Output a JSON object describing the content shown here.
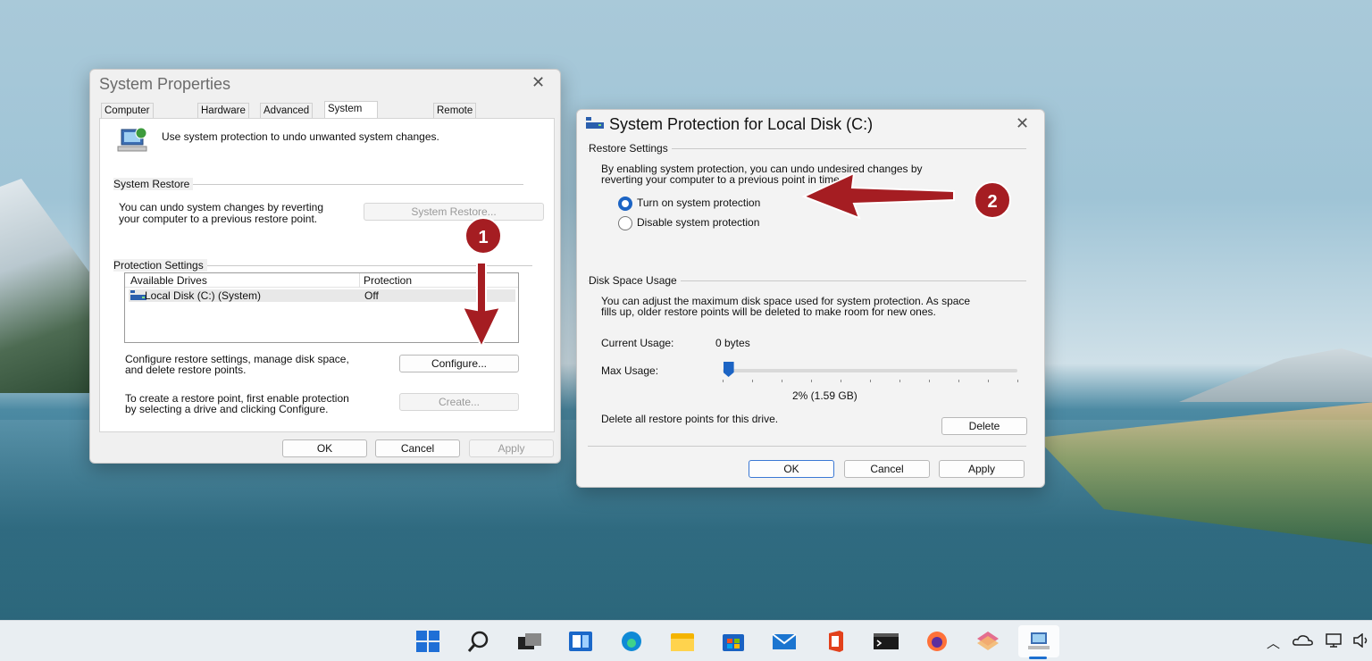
{
  "system_properties": {
    "title": "System Properties",
    "tabs": [
      "Computer Name",
      "Hardware",
      "Advanced",
      "System Protection",
      "Remote"
    ],
    "active_tab": "System Protection",
    "intro_text": "Use system protection to undo unwanted system changes.",
    "system_restore": {
      "group_title": "System Restore",
      "description_line1": "You can undo system changes by reverting",
      "description_line2": "your computer to a previous restore point.",
      "button_label": "System Restore..."
    },
    "protection_settings": {
      "group_title": "Protection Settings",
      "columns": [
        "Available Drives",
        "Protection"
      ],
      "rows": [
        {
          "drive": "Local Disk (C:) (System)",
          "protection": "Off",
          "icon": "drive-icon"
        }
      ],
      "configure_text_line1": "Configure restore settings, manage disk space,",
      "configure_text_line2": "and delete restore points.",
      "configure_button": "Configure...",
      "create_text_line1": "To create a restore point, first enable protection",
      "create_text_line2": "by selecting a drive and clicking Configure.",
      "create_button": "Create..."
    },
    "footer": {
      "ok": "OK",
      "cancel": "Cancel",
      "apply": "Apply"
    }
  },
  "system_protection_dialog": {
    "title": "System Protection for Local Disk (C:)",
    "restore_settings": {
      "group_title": "Restore Settings",
      "description_line1": "By enabling system protection, you can undo undesired changes by",
      "description_line2": "reverting your computer to a previous point in time.",
      "options": [
        {
          "label": "Turn on system protection",
          "checked": true
        },
        {
          "label": "Disable system protection",
          "checked": false
        }
      ]
    },
    "disk_space": {
      "group_title": "Disk Space Usage",
      "description_line1": "You can adjust the maximum disk space used for system protection. As space",
      "description_line2": "fills up, older restore points will be deleted to make room for new ones.",
      "current_usage_label": "Current Usage:",
      "current_usage_value": "0 bytes",
      "max_usage_label": "Max Usage:",
      "max_usage_fraction": 0.02,
      "max_usage_display": "2% (1.59 GB)",
      "delete_text": "Delete all restore points for this drive.",
      "delete_button": "Delete"
    },
    "footer": {
      "ok": "OK",
      "cancel": "Cancel",
      "apply": "Apply"
    }
  },
  "annotations": {
    "step1": "1",
    "step2": "2",
    "arrow_color": "#a51d22"
  },
  "taskbar": {
    "icons": [
      "start-icon",
      "search-icon",
      "task-view-icon",
      "widgets-icon",
      "edge-icon",
      "file-explorer-icon",
      "store-icon",
      "mail-icon",
      "office-icon",
      "terminal-icon",
      "firefox-icon",
      "snipping-icon",
      "system-properties-icon"
    ],
    "tray_icons": [
      "chevron-up-icon",
      "onedrive-icon",
      "network-icon",
      "volume-icon"
    ]
  }
}
